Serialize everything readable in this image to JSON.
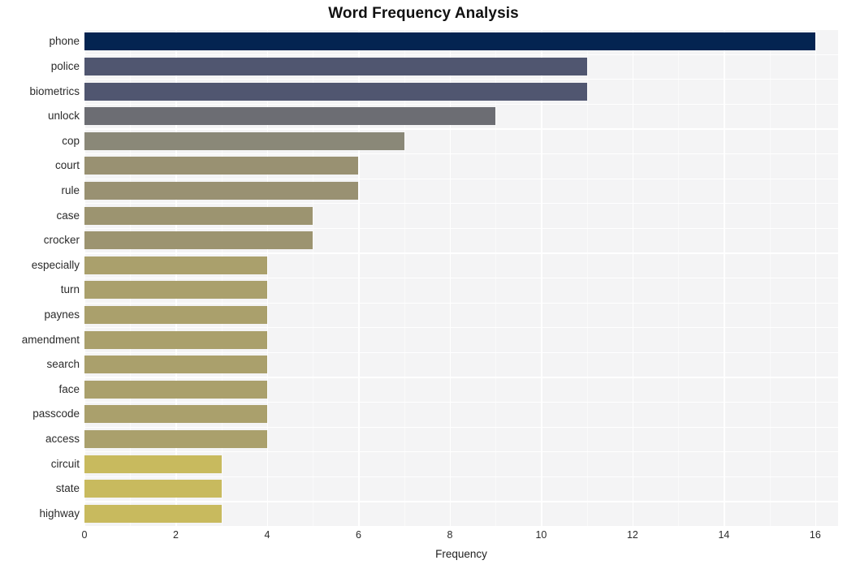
{
  "chart_data": {
    "type": "bar",
    "orientation": "horizontal",
    "title": "Word Frequency Analysis",
    "xlabel": "Frequency",
    "ylabel": "",
    "categories": [
      "phone",
      "police",
      "biometrics",
      "unlock",
      "cop",
      "court",
      "rule",
      "case",
      "crocker",
      "especially",
      "turn",
      "paynes",
      "amendment",
      "search",
      "face",
      "passcode",
      "access",
      "circuit",
      "state",
      "highway"
    ],
    "values": [
      16,
      11,
      11,
      9,
      7,
      6,
      6,
      5,
      5,
      4,
      4,
      4,
      4,
      4,
      4,
      4,
      4,
      3,
      3,
      3
    ],
    "xlim": [
      0,
      16.5
    ],
    "xticks": [
      0,
      2,
      4,
      6,
      8,
      10,
      12,
      14,
      16
    ],
    "xtick_labels": [
      "0",
      "2",
      "4",
      "6",
      "8",
      "10",
      "12",
      "14",
      "16"
    ],
    "grid": true,
    "grid_color": "#ffffff",
    "plot_background": "#f4f4f5",
    "figure_background": "#ffffff",
    "legend": null,
    "bar_colors": [
      "#042451",
      "#505670",
      "#505670",
      "#6c6d73",
      "#8a8878",
      "#999172",
      "#999172",
      "#9c9470",
      "#9c9470",
      "#aaa06c",
      "#aaa06c",
      "#aaa06c",
      "#aaa06c",
      "#aaa06c",
      "#aaa06c",
      "#aaa06c",
      "#aaa06c",
      "#c8ba5e",
      "#c8ba5e",
      "#c8ba5e"
    ]
  }
}
